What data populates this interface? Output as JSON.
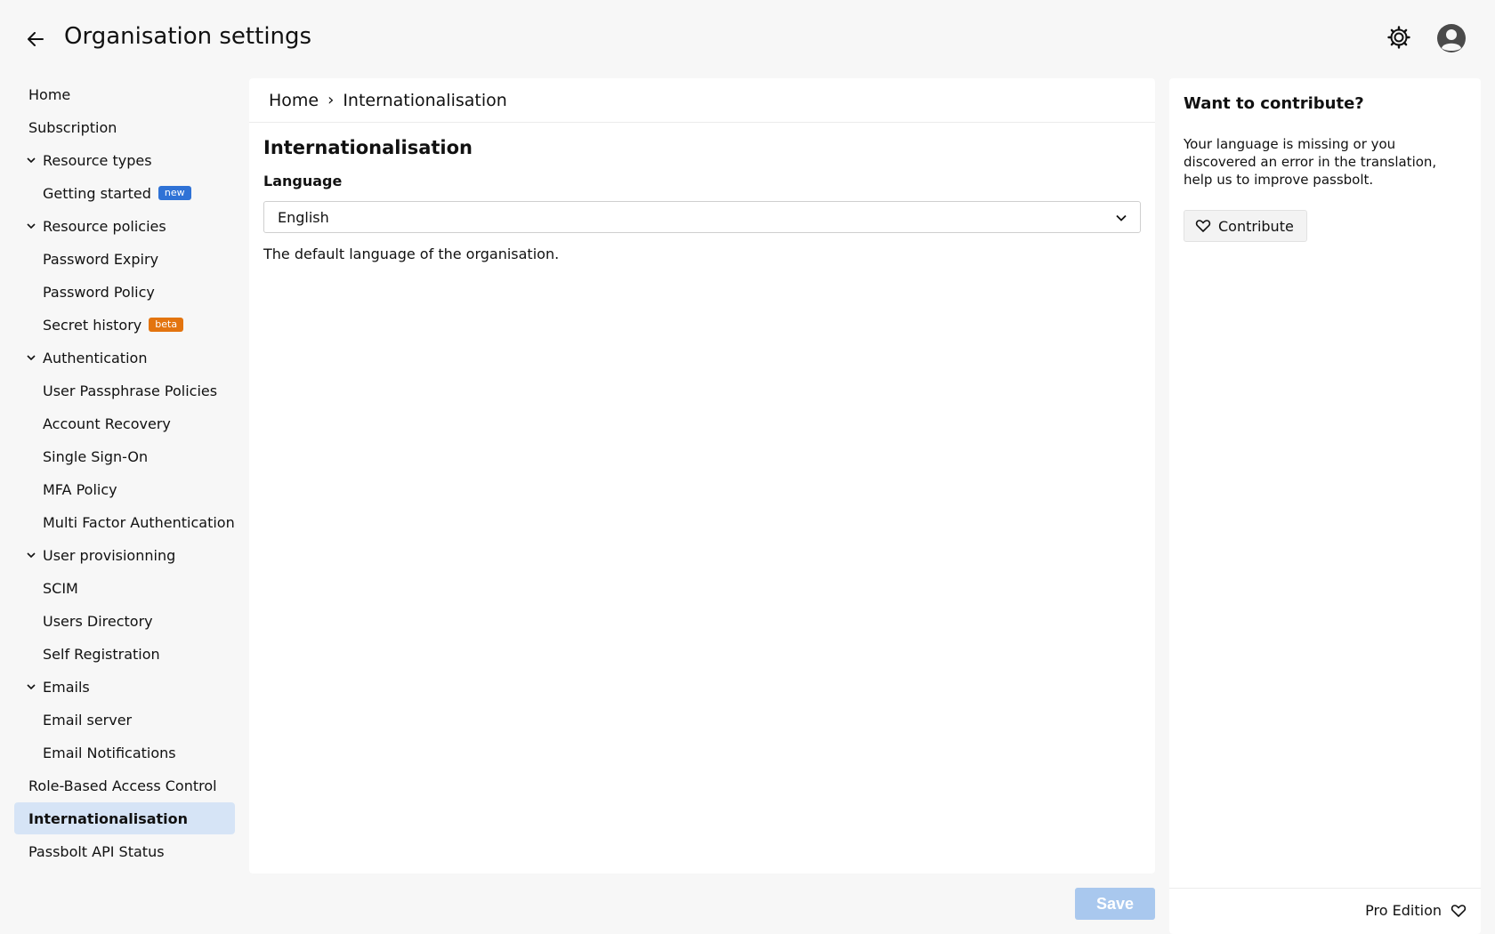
{
  "header": {
    "title": "Organisation settings"
  },
  "sidebar": {
    "items": [
      {
        "label": "Home"
      },
      {
        "label": "Subscription"
      },
      {
        "label": "Resource types"
      },
      {
        "label": "Getting started",
        "badge": "new"
      },
      {
        "label": "Resource policies"
      },
      {
        "label": "Password Expiry"
      },
      {
        "label": "Password Policy"
      },
      {
        "label": "Secret history",
        "badge": "beta"
      },
      {
        "label": "Authentication"
      },
      {
        "label": "User Passphrase Policies"
      },
      {
        "label": "Account Recovery"
      },
      {
        "label": "Single Sign-On"
      },
      {
        "label": "MFA Policy"
      },
      {
        "label": "Multi Factor Authentication"
      },
      {
        "label": "User provisionning"
      },
      {
        "label": "SCIM"
      },
      {
        "label": "Users Directory"
      },
      {
        "label": "Self Registration"
      },
      {
        "label": "Emails"
      },
      {
        "label": "Email server"
      },
      {
        "label": "Email Notifications"
      },
      {
        "label": "Role-Based Access Control"
      },
      {
        "label": "Internationalisation"
      },
      {
        "label": "Passbolt API Status"
      }
    ]
  },
  "breadcrumb": {
    "home": "Home",
    "separator": "›",
    "current": "Internationalisation"
  },
  "main": {
    "title": "Internationalisation",
    "language_label": "Language",
    "language_value": "English",
    "help_text": "The default language of the organisation.",
    "save_label": "Save"
  },
  "aside": {
    "title": "Want to contribute?",
    "text": "Your language is missing or you discovered an error in the translation, help us to improve passbolt.",
    "contribute_label": "Contribute",
    "edition_label": "Pro Edition"
  },
  "colors": {
    "active_bg": "#d6e4f6",
    "badge_new": "#2f72d6",
    "badge_beta": "#e3740f",
    "save_disabled": "#a9c8ee"
  }
}
